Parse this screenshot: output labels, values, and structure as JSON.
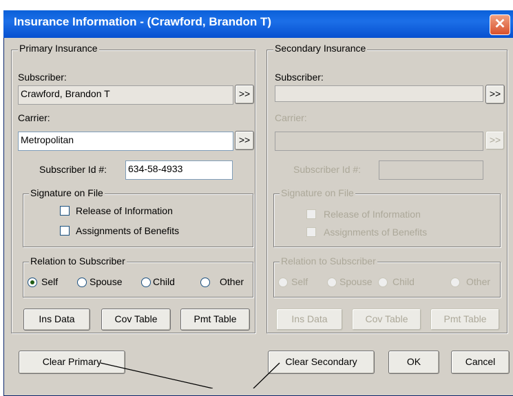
{
  "window": {
    "title": "Insurance Information - (Crawford, Brandon T)",
    "close_glyph": "✕"
  },
  "primary": {
    "legend": "Primary Insurance",
    "subscriber_label": "Subscriber:",
    "subscriber_value": "Crawford, Brandon T",
    "subscriber_button": ">>",
    "carrier_label": "Carrier:",
    "carrier_value": "Metropolitan",
    "carrier_button": ">>",
    "subscriber_id_label": "Subscriber Id #:",
    "subscriber_id_value": "634-58-4933",
    "signature_legend": "Signature on File",
    "release_label": "Release of Information",
    "release_checked": false,
    "assignments_label": "Assignments of Benefits",
    "assignments_checked": false,
    "relation_legend": "Relation to Subscriber",
    "relations": [
      "Self",
      "Spouse",
      "Child",
      "Other"
    ],
    "relation_selected": "Self",
    "buttons": [
      "Ins Data",
      "Cov Table",
      "Pmt Table"
    ]
  },
  "secondary": {
    "legend": "Secondary Insurance",
    "subscriber_label": "Subscriber:",
    "subscriber_value": "",
    "subscriber_button": ">>",
    "carrier_label": "Carrier:",
    "carrier_value": "",
    "carrier_button": ">>",
    "subscriber_id_label": "Subscriber Id #:",
    "subscriber_id_value": "",
    "signature_legend": "Signature on File",
    "release_label": "Release of Information",
    "assignments_label": "Assignments of Benefits",
    "relation_legend": "Relation to Subscriber",
    "relations": [
      "Self",
      "Spouse",
      "Child",
      "Other"
    ],
    "buttons": [
      "Ins Data",
      "Cov Table",
      "Pmt Table"
    ]
  },
  "footer": {
    "clear_primary": "Clear Primary",
    "clear_secondary": "Clear Secondary",
    "ok": "OK",
    "cancel": "Cancel"
  }
}
